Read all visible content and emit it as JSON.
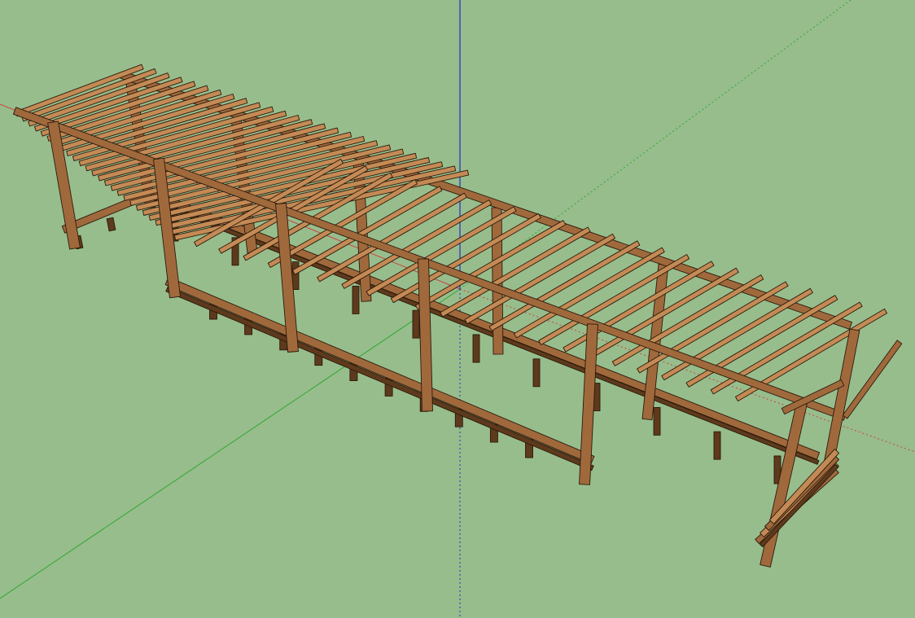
{
  "viewport": {
    "background_color": "#97bd8c"
  },
  "axes": {
    "red_axis_color": "#d04040",
    "green_axis_color": "#2fa82f",
    "blue_axis_color": "#2a2ad0"
  },
  "model": {
    "name": "pergola",
    "wood_color": "#a0693c",
    "wood_light_color": "#c48a55",
    "wood_dark_color": "#5e3a1c",
    "edge_color": "#2a1a0c",
    "counts": {
      "rafters_left_section": 26,
      "rafters_right_section": 23,
      "front_posts": 5,
      "back_posts": 5,
      "bench_legs": 21
    }
  }
}
